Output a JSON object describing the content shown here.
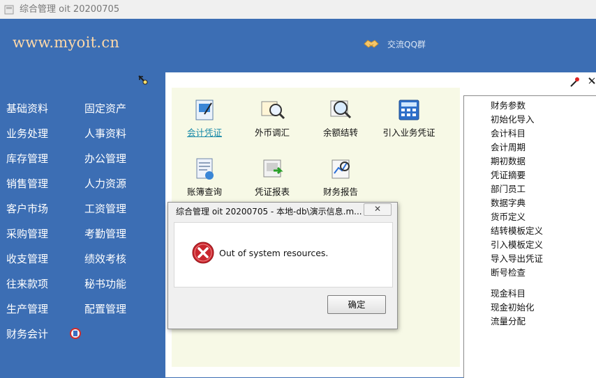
{
  "window": {
    "title": "综合管理 oit 20200705"
  },
  "header": {
    "site_url": "www.myoit.cn",
    "qq_group_label": "交流QQ群"
  },
  "sidebar": {
    "col1": [
      "基础资料",
      "业务处理",
      "库存管理",
      "销售管理",
      "客户市场",
      "采购管理",
      "收支管理",
      "往来款项",
      "生产管理",
      "财务会计"
    ],
    "col2": [
      "固定资产",
      "人事资料",
      "办公管理",
      "人力资源",
      "工资管理",
      "考勤管理",
      "绩效考核",
      "秘书功能",
      "配置管理"
    ]
  },
  "tools": [
    {
      "label": "会计凭证",
      "icon": "voucher-icon"
    },
    {
      "label": "外币调汇",
      "icon": "currency-exchange-icon"
    },
    {
      "label": "余额结转",
      "icon": "balance-carryover-icon"
    },
    {
      "label": "引入业务凭证",
      "icon": "calculator-icon"
    },
    {
      "label": "账簿查询",
      "icon": "ledger-query-icon"
    },
    {
      "label": "凭证报表",
      "icon": "voucher-report-icon"
    },
    {
      "label": "财务报告",
      "icon": "financial-report-icon"
    }
  ],
  "right_panel": {
    "items": [
      "财务参数",
      "初始化导入",
      "会计科目",
      "会计周期",
      "期初数据",
      "凭证摘要",
      "部门员工",
      "数据字典",
      "货币定义",
      "结转模板定义",
      "引入模板定义",
      "导入导出凭证",
      "断号检查"
    ],
    "cash_items": [
      "现金科目",
      "现金初始化",
      "流量分配"
    ]
  },
  "dialog": {
    "title": "综合管理 oit 20200705 - 本地-db\\演示信息.m...",
    "close_label": "✕",
    "message": "Out of system resources.",
    "ok_label": "确定"
  },
  "colors": {
    "sidebar_bg": "#3c6eb4",
    "site_text": "#ffd9a8",
    "link": "#1a8aa8",
    "error_red": "#c8262e"
  }
}
